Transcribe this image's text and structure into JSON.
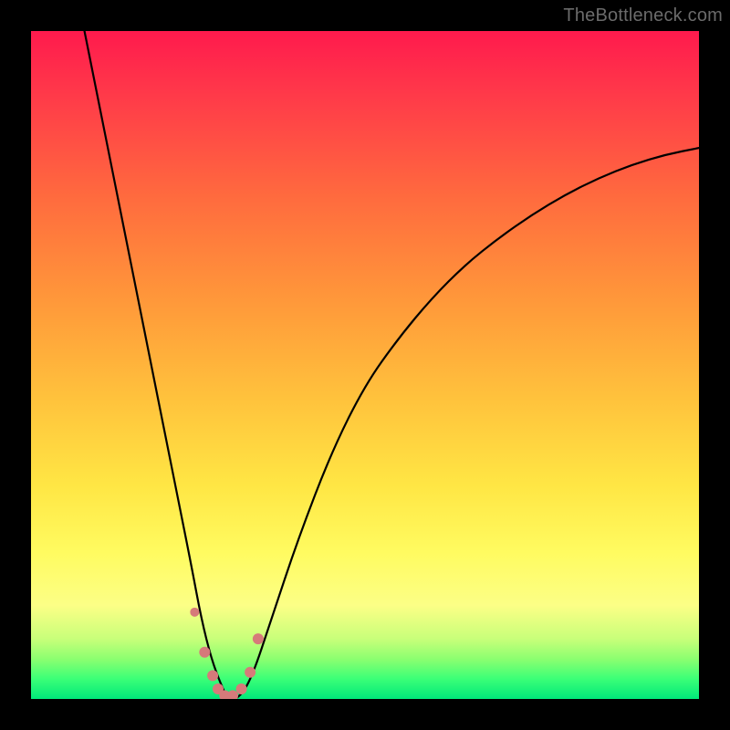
{
  "watermark": "TheBottleneck.com",
  "colors": {
    "frame": "#000000",
    "curve": "#000000",
    "marker": "#d67a7a",
    "watermark_text": "#6b6b6b"
  },
  "chart_data": {
    "type": "line",
    "title": "",
    "xlabel": "",
    "ylabel": "",
    "xlim": [
      0,
      100
    ],
    "ylim": [
      0,
      100
    ],
    "series": [
      {
        "name": "bottleneck-curve",
        "x": [
          8,
          10,
          12,
          14,
          16,
          18,
          20,
          22,
          24,
          25.5,
          27,
          28.5,
          29.5,
          31,
          33,
          36,
          40,
          45,
          50,
          55,
          60,
          65,
          70,
          75,
          80,
          85,
          90,
          95,
          100
        ],
        "y": [
          100,
          90,
          80,
          70,
          60,
          50,
          40,
          30,
          20,
          12,
          6,
          2,
          0,
          0,
          3,
          12,
          24,
          37,
          47,
          54,
          60,
          65,
          69,
          72.5,
          75.5,
          78,
          80,
          81.5,
          82.5
        ]
      }
    ],
    "markers": {
      "name": "highlight-points",
      "x": [
        24.5,
        26.0,
        27.2,
        28.0,
        29.0,
        30.2,
        31.5,
        32.8,
        34.0
      ],
      "y": [
        13,
        7,
        3.5,
        1.5,
        0.5,
        0.5,
        1.5,
        4,
        9
      ],
      "r": [
        5,
        6,
        6,
        6,
        6,
        6,
        6,
        6,
        6
      ]
    }
  }
}
